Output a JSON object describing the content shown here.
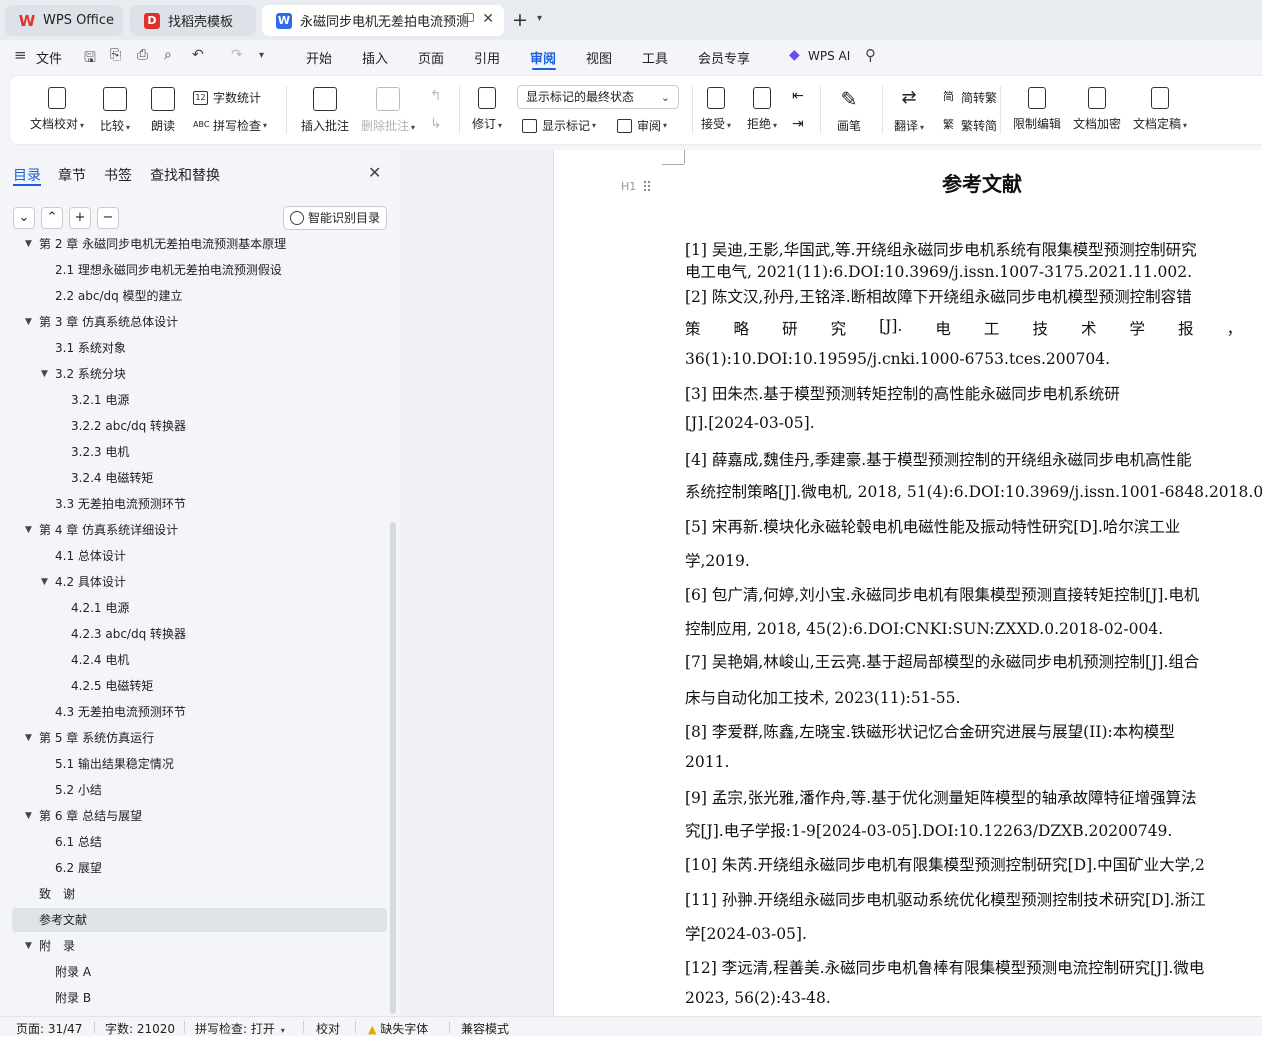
{
  "tabs": [
    {
      "label": "WPS Office"
    },
    {
      "label": "找稻壳模板"
    },
    {
      "label": "永磁同步电机无差拍电流预测控"
    }
  ],
  "menubar": {
    "file": "文件",
    "items": [
      "开始",
      "插入",
      "页面",
      "引用",
      "审阅",
      "视图",
      "工具",
      "会员专享"
    ],
    "active": "审阅",
    "ai": "WPS AI"
  },
  "ribbon": {
    "doc_proof": "文档校对",
    "compare": "比较",
    "read_aloud": "朗读",
    "word_count": "字数统计",
    "spell_check": "拼写检查",
    "insert_comment": "插入批注",
    "delete_comment": "删除批注",
    "track_changes": "修订",
    "markup_state": "显示标记的最终状态",
    "show_markup": "显示标记",
    "review": "审阅",
    "accept": "接受",
    "reject": "拒绝",
    "pen": "画笔",
    "translate": "翻译",
    "to_traditional": "简转繁",
    "to_simplified": "繁转简",
    "restrict_edit": "限制编辑",
    "encrypt": "文档加密",
    "finalize": "文档定稿"
  },
  "left_panel": {
    "tabs": [
      "目录",
      "章节",
      "书签",
      "查找和替换"
    ],
    "smart_toc": "智能识别目录",
    "toc": [
      {
        "label": "第 2 章 永磁同步电机无差拍电流预测基本原理",
        "level": 1,
        "expanded": true
      },
      {
        "label": "2.1 理想永磁同步电机无差拍电流预测假设",
        "level": 2
      },
      {
        "label": "2.2 abc/dq 模型的建立",
        "level": 2
      },
      {
        "label": "第 3 章 仿真系统总体设计",
        "level": 1,
        "expanded": true
      },
      {
        "label": "3.1 系统对象",
        "level": 2
      },
      {
        "label": "3.2 系统分块",
        "level": 2,
        "expanded": true
      },
      {
        "label": "3.2.1 电源",
        "level": 3
      },
      {
        "label": "3.2.2 abc/dq 转换器",
        "level": 3
      },
      {
        "label": "3.2.3 电机",
        "level": 3
      },
      {
        "label": "3.2.4 电磁转矩",
        "level": 3
      },
      {
        "label": "3.3 无差拍电流预测环节",
        "level": 2
      },
      {
        "label": "第 4 章 仿真系统详细设计",
        "level": 1,
        "expanded": true
      },
      {
        "label": "4.1 总体设计",
        "level": 2
      },
      {
        "label": "4.2 具体设计",
        "level": 2,
        "expanded": true
      },
      {
        "label": "4.2.1 电源",
        "level": 3
      },
      {
        "label": "4.2.3 abc/dq 转换器",
        "level": 3
      },
      {
        "label": "4.2.4 电机",
        "level": 3
      },
      {
        "label": "4.2.5 电磁转矩",
        "level": 3
      },
      {
        "label": "4.3 无差拍电流预测环节",
        "level": 2
      },
      {
        "label": "第 5 章 系统仿真运行",
        "level": 1,
        "expanded": true
      },
      {
        "label": "5.1 输出结果稳定情况",
        "level": 2
      },
      {
        "label": "5.2 小结",
        "level": 2
      },
      {
        "label": "第 6 章 总结与展望",
        "level": 1,
        "expanded": true
      },
      {
        "label": "6.1 总结",
        "level": 2
      },
      {
        "label": "6.2 展望",
        "level": 2
      },
      {
        "label": "致　谢",
        "level": 1
      },
      {
        "label": "参考文献",
        "level": 1,
        "selected": true
      },
      {
        "label": "附　录",
        "level": 1,
        "expanded": true
      },
      {
        "label": "附录 A",
        "level": 2
      },
      {
        "label": "附录 B",
        "level": 2
      }
    ]
  },
  "document": {
    "title": "参考文献",
    "heading_marker": "H1",
    "refs": [
      {
        "lines": [
          "[1]  吴迪,王影,华国武,等.开绕组永磁同步电机系统有限集模型预测控制研究",
          "电工电气, 2021(11):6.DOI:10.3969/j.issn.1007-3175.2021.11.002."
        ]
      },
      {
        "lines": [
          "[2]  陈文汉,孙丹,王铭泽.断相故障下开绕组永磁同步电机模型预测控制容错",
          "策 略 研 究 [J]. 电 工 技 术 学 报 ， 2",
          "36(1):10.DOI:10.19595/j.cnki.1000-6753.tces.200704."
        ]
      },
      {
        "lines": [
          "[3]  田朱杰.基于模型预测转矩控制的高性能永磁同步电机系统研",
          "[J].[2024-03-05]."
        ]
      },
      {
        "lines": [
          "[4]  薛嘉成,魏佳丹,季建豪.基于模型预测控制的开绕组永磁同步电机高性能",
          "系统控制策略[J].微电机, 2018, 51(4):6.DOI:10.3969/j.issn.1001-6848.2018.04.0"
        ]
      },
      {
        "lines": [
          "[5]  宋再新.模块化永磁轮毂电机电磁性能及振动特性研究[D].哈尔滨工业",
          "学,2019."
        ]
      },
      {
        "lines": [
          "[6]  包广清,何婷,刘小宝.永磁同步电机有限集模型预测直接转矩控制[J].电机",
          "控制应用, 2018, 45(2):6.DOI:CNKI:SUN:ZXXD.0.2018-02-004."
        ]
      },
      {
        "lines": [
          "[7]  吴艳娟,林峻山,王云亮.基于超局部模型的永磁同步电机预测控制[J].组合",
          "床与自动化加工技术, 2023(11):51-55."
        ]
      },
      {
        "lines": [
          "[8]  李爱群,陈鑫,左晓宝.铁磁形状记忆合金研究进展与展望(II):本构模型",
          "2011."
        ]
      },
      {
        "lines": [
          "[9]  孟宗,张光雅,潘作舟,等.基于优化测量矩阵模型的轴承故障特征增强算法",
          "究[J].电子学报:1-9[2024-03-05].DOI:10.12263/DZXB.20200749."
        ]
      },
      {
        "lines": [
          "[10]  朱芮.开绕组永磁同步电机有限集模型预测控制研究[D].中国矿业大学,2"
        ]
      },
      {
        "lines": [
          "[11]  孙翀.开绕组永磁同步电机驱动系统优化模型预测控制技术研究[D].浙江",
          "学[2024-03-05]."
        ]
      },
      {
        "lines": [
          "[12]  李远清,程善美.永磁同步电机鲁棒有限集模型预测电流控制研究[J].微电",
          "2023, 56(2):43-48."
        ]
      }
    ]
  },
  "statusbar": {
    "page": "页面: 31/47",
    "words": "字数: 21020",
    "spell": "拼写检查: 打开",
    "proof": "校对",
    "missing_font": "缺失字体",
    "compat": "兼容模式"
  }
}
